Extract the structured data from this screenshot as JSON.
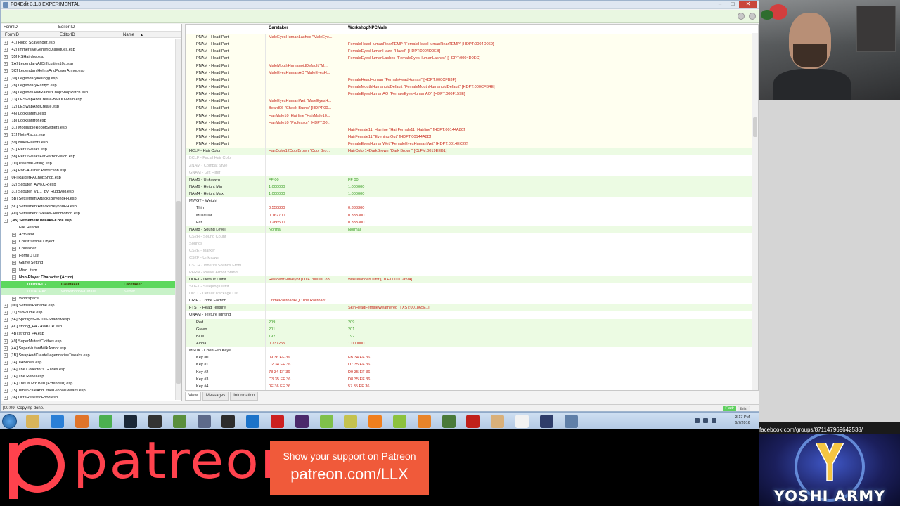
{
  "app": {
    "title": "FO4Edit 3.1.3 EXPERIMENTAL"
  },
  "filters": {
    "formid_label": "FormID",
    "editorid_label": "Editor ID"
  },
  "left_columns": {
    "formid": "FormID",
    "editorid": "EditorID",
    "name": "Name"
  },
  "tree": [
    {
      "indent": 0,
      "label": "[41] Hobo Scavenger.esp",
      "exp": "+"
    },
    {
      "indent": 0,
      "label": "[42] ImmersiveGenericDialogues.esp",
      "exp": "+"
    },
    {
      "indent": 0,
      "label": "[35] KSHairdos.esp",
      "exp": "+"
    },
    {
      "indent": 0,
      "label": "[2A] LegendaryAllDifficulties10x.esp",
      "exp": "+"
    },
    {
      "indent": 0,
      "label": "[3C] LegendaryHelmsAndPowerArmor.esp",
      "exp": "+"
    },
    {
      "indent": 0,
      "label": "[30] LegendaryKellogg.esp",
      "exp": "+"
    },
    {
      "indent": 0,
      "label": "[28] LegendaryRarity5.esp",
      "exp": "+"
    },
    {
      "indent": 0,
      "label": "[38] LegendsAndRaiderChopShopPatch.esp",
      "exp": "+"
    },
    {
      "indent": 0,
      "label": "[13] LESwapAndCreate-BMOD-Main.esp",
      "exp": "+"
    },
    {
      "indent": 0,
      "label": "[12] LESwapAndCreate.esp",
      "exp": "+"
    },
    {
      "indent": 0,
      "label": "[46] LooksMenu.esp",
      "exp": "+"
    },
    {
      "indent": 0,
      "label": "[18] LooksMirror.esp",
      "exp": "+"
    },
    {
      "indent": 0,
      "label": "[31] ModdableRobotSettlers.esp",
      "exp": "+"
    },
    {
      "indent": 0,
      "label": "[21] NoteRacks.esp",
      "exp": "+"
    },
    {
      "indent": 0,
      "label": "[59] NukaFlavors.esp",
      "exp": "+"
    },
    {
      "indent": 0,
      "label": "[57] PerkTweaks.esp",
      "exp": "+"
    },
    {
      "indent": 0,
      "label": "[58] PerkTweaksFarHarborPatch.esp",
      "exp": "+"
    },
    {
      "indent": 0,
      "label": "[1D] PlasmaGatling.esp",
      "exp": "+"
    },
    {
      "indent": 0,
      "label": "[24] Port-A-Diner Perfection.esp",
      "exp": "+"
    },
    {
      "indent": 0,
      "label": "[0F] RaiderPAChopShop.esp",
      "exp": "+"
    },
    {
      "indent": 0,
      "label": "[32] Scouter_AWKCR.esp",
      "exp": "+"
    },
    {
      "indent": 0,
      "label": "[31] Scouter_V1.1_by_Ruddy88.esp",
      "exp": "+"
    },
    {
      "indent": 0,
      "label": "[5B] SettlementAttacksBeyondFH.esp",
      "exp": "+"
    },
    {
      "indent": 0,
      "label": "[5C] SettlementAttacksBeyondFH.esp",
      "exp": "+"
    },
    {
      "indent": 0,
      "label": "[4D] SettlementTweaks-Automotron.esp",
      "exp": "+"
    },
    {
      "indent": 0,
      "label": "[3B] SettlementTweaks-Core.esp",
      "exp": "-",
      "bold": true
    },
    {
      "indent": 1,
      "label": "File Header",
      "exp": ""
    },
    {
      "indent": 1,
      "label": "Activator",
      "exp": "+"
    },
    {
      "indent": 1,
      "label": "Constructible Object",
      "exp": "+"
    },
    {
      "indent": 1,
      "label": "Container",
      "exp": "+"
    },
    {
      "indent": 1,
      "label": "FormID List",
      "exp": "+"
    },
    {
      "indent": 1,
      "label": "Game Setting",
      "exp": "+"
    },
    {
      "indent": 1,
      "label": "Misc. Item",
      "exp": "+"
    },
    {
      "indent": 1,
      "label": "Non-Player Character (Actor)",
      "exp": "-",
      "bold": true
    },
    {
      "indent": 2,
      "label": "000B3EC7",
      "exp": "",
      "c2": "Caretaker",
      "c3": "Caretaker",
      "sel": "sel"
    },
    {
      "indent": 2,
      "label": "0014CEA8",
      "exp": "",
      "c2": "WorkshopNPCMale",
      "c3": "Settler",
      "sel": "sel2"
    },
    {
      "indent": 1,
      "label": "Workspace",
      "exp": "+"
    },
    {
      "indent": 0,
      "label": "[0D] SettlersRename.esp",
      "exp": "+"
    },
    {
      "indent": 0,
      "label": "[11] SlowTime.esp",
      "exp": "+"
    },
    {
      "indent": 0,
      "label": "[5F] SpotlightFix-100-Shadow.esp",
      "exp": "+"
    },
    {
      "indent": 0,
      "label": "[4C] strong_PA - AWKCR.esp",
      "exp": "+"
    },
    {
      "indent": 0,
      "label": "[4B] strong_PA.esp",
      "exp": "+"
    },
    {
      "indent": 0,
      "label": "[49] SuperMutantClothes.esp",
      "exp": "+"
    },
    {
      "indent": 0,
      "label": "[4A] SuperMutantMilkArmor.esp",
      "exp": "+"
    },
    {
      "indent": 0,
      "label": "[1B] SwapAndCreateLegendariesTweaks.esp",
      "exp": "+"
    },
    {
      "indent": 0,
      "label": "[14] THBrows.esp",
      "exp": "+"
    },
    {
      "indent": 0,
      "label": "[3F] The Collector's Guides.esp",
      "exp": "+"
    },
    {
      "indent": 0,
      "label": "[1F] The Rebel.esp",
      "exp": "+"
    },
    {
      "indent": 0,
      "label": "[1E] This is MY Bed (Extended).esp",
      "exp": "+"
    },
    {
      "indent": 0,
      "label": "[15] TimeScaleAndOtherGlobalTweaks.esp",
      "exp": "+"
    },
    {
      "indent": 0,
      "label": "[36] UltraRealisticFood.esp",
      "exp": "+"
    }
  ],
  "record_header": {
    "col1": "Caretaker",
    "col2": "WorkshopNPCMale"
  },
  "record_rows": [
    {
      "label": "PNAM - Head Part",
      "i": 1,
      "v1": "MaleEyesHumanLashes \"MaleEye...",
      "v2": "",
      "c": "red",
      "bg": "hl"
    },
    {
      "label": "PNAM - Head Part",
      "i": 1,
      "v1": "",
      "v2": "FemaleHeadHumanRearTEMP \"FemaleHeadHumanRearTEMP\" [HDPT:0004D069]",
      "c": "red",
      "bg": "hl"
    },
    {
      "label": "PNAM - Head Part",
      "i": 1,
      "v1": "",
      "v2": "FemaleEyesHumanHazel \"Hazel\" [HDPT:0004D0EB]",
      "c": "red",
      "bg": "hl"
    },
    {
      "label": "PNAM - Head Part",
      "i": 1,
      "v1": "",
      "v2": "FemaleEyesHumanLashes \"FemaleEyesHumanLashes\" [HDPT:0004D0EC]",
      "c": "red",
      "bg": "hl"
    },
    {
      "label": "PNAM - Head Part",
      "i": 1,
      "v1": "MaleMouthHumanoidDefault \"M...",
      "v2": "",
      "c": "red",
      "bg": "hl"
    },
    {
      "label": "PNAM - Head Part",
      "i": 1,
      "v1": "MaleEyesHumanAO \"MaleEyesH...",
      "v2": "",
      "c": "red",
      "bg": "hl"
    },
    {
      "label": "PNAM - Head Part",
      "i": 1,
      "v1": "",
      "v2": "FemaleHeadHuman \"FemaleHeadHuman\" [HDPT:000CFB3F]",
      "c": "red",
      "bg": "hl"
    },
    {
      "label": "PNAM - Head Part",
      "i": 1,
      "v1": "",
      "v2": "FemaleMouthHumanoidDefault \"FemaleMouthHumanoidDefault\" [HDPT:000CFB4E]",
      "c": "red",
      "bg": "hl"
    },
    {
      "label": "PNAM - Head Part",
      "i": 1,
      "v1": "",
      "v2": "FemaleEyesHumanAO \"FemaleEyesHumanAO\" [HDPT:000F159E]",
      "c": "red",
      "bg": "hl"
    },
    {
      "label": "PNAM - Head Part",
      "i": 1,
      "v1": "MaleEyesHumanWet \"MaleEyesH...",
      "v2": "",
      "c": "red",
      "bg": "hl"
    },
    {
      "label": "PNAM - Head Part",
      "i": 1,
      "v1": "Beard06 \"Cheek Burns\" [HDPT:00...",
      "v2": "",
      "c": "red",
      "bg": "hl"
    },
    {
      "label": "PNAM - Head Part",
      "i": 1,
      "v1": "HairMale10_Hairline \"HairMale10...",
      "v2": "",
      "c": "red",
      "bg": "hl"
    },
    {
      "label": "PNAM - Head Part",
      "i": 1,
      "v1": "HairMale10 \"Professor\" [HDPT:00...",
      "v2": "",
      "c": "red",
      "bg": "hl"
    },
    {
      "label": "PNAM - Head Part",
      "i": 1,
      "v1": "",
      "v2": "HairFemale11_Hairline \"HairFemale11_Hairline\" [HDPT:00144A8C]",
      "c": "red",
      "bg": "hl"
    },
    {
      "label": "PNAM - Head Part",
      "i": 1,
      "v1": "",
      "v2": "HairFemale11 \"Evening Out\" [HDPT:00144A8D]",
      "c": "red",
      "bg": "hl"
    },
    {
      "label": "PNAM - Head Part",
      "i": 1,
      "v1": "",
      "v2": "FemaleEyesHumanWet \"FemaleEyesHumanWet\" [HDPT:0014EC22]",
      "c": "red",
      "bg": "hl"
    },
    {
      "label": "HCLF - Hair Color",
      "i": 0,
      "v1": "HairColor12CoolBrown \"Cool Bro...",
      "v2": "HairColor14DarkBrown \"Dark Brown\" [CLFM:0019EEB1]",
      "c": "red",
      "bg": "green"
    },
    {
      "label": "BCLF - Facial Hair Color",
      "i": 0,
      "v1": "",
      "v2": "",
      "c": "",
      "bg": "",
      "dim": true
    },
    {
      "label": "ZNAM - Combat Style",
      "i": 0,
      "v1": "",
      "v2": "",
      "c": "",
      "bg": "",
      "dim": true
    },
    {
      "label": "GNAM - Gift Filter",
      "i": 0,
      "v1": "",
      "v2": "",
      "c": "",
      "bg": "",
      "dim": true
    },
    {
      "label": "NAM5 - Unknown",
      "i": 0,
      "v1": "FF 00",
      "v2": "FF 00",
      "c": "grn",
      "bg": "green"
    },
    {
      "label": "NAM6 - Height Min",
      "i": 0,
      "v1": "1.000000",
      "v2": "1.000000",
      "c": "grn",
      "bg": "green"
    },
    {
      "label": "NAM4 - Height Max",
      "i": 0,
      "v1": "1.000000",
      "v2": "1.000000",
      "c": "grn",
      "bg": "green"
    },
    {
      "label": "MWGT - Weight",
      "i": 0,
      "v1": "",
      "v2": "",
      "c": "",
      "bg": ""
    },
    {
      "label": "Thin",
      "i": 1,
      "v1": "0.550800",
      "v2": "0.333300",
      "c": "red",
      "bg": ""
    },
    {
      "label": "Muscular",
      "i": 1,
      "v1": "0.162700",
      "v2": "0.333300",
      "c": "red",
      "bg": ""
    },
    {
      "label": "Fat",
      "i": 1,
      "v1": "0.286500",
      "v2": "0.333300",
      "c": "red",
      "bg": ""
    },
    {
      "label": "NAM8 - Sound Level",
      "i": 0,
      "v1": "Normal",
      "v2": "Normal",
      "c": "grn",
      "bg": "green"
    },
    {
      "label": "CS2H - Sound Count",
      "i": 0,
      "v1": "",
      "v2": "",
      "c": "",
      "bg": "",
      "dim": true
    },
    {
      "label": "Sounds",
      "i": 0,
      "v1": "",
      "v2": "",
      "c": "",
      "bg": "",
      "dim": true
    },
    {
      "label": "CS2E - Marker",
      "i": 0,
      "v1": "",
      "v2": "",
      "c": "",
      "bg": "",
      "dim": true
    },
    {
      "label": "CS2F - Unknown",
      "i": 0,
      "v1": "",
      "v2": "",
      "c": "",
      "bg": "",
      "dim": true
    },
    {
      "label": "CSCR - Inherits Sounds From",
      "i": 0,
      "v1": "",
      "v2": "",
      "c": "",
      "bg": "",
      "dim": true
    },
    {
      "label": "PFRN - Power Armor Stand",
      "i": 0,
      "v1": "",
      "v2": "",
      "c": "",
      "bg": "",
      "dim": true
    },
    {
      "label": "DOFT - Default Outfit",
      "i": 0,
      "v1": "ResidentSurveyor [OTFT:000DC83...",
      "v2": "WastelanderOutfit [OTFT:001C269A]",
      "c": "red",
      "bg": "green"
    },
    {
      "label": "SOFT - Sleeping Outfit",
      "i": 0,
      "v1": "",
      "v2": "",
      "c": "",
      "bg": "",
      "dim": true
    },
    {
      "label": "DPLT - Default Package List",
      "i": 0,
      "v1": "",
      "v2": "",
      "c": "",
      "bg": "",
      "dim": true
    },
    {
      "label": "CRIF - Crime Faction",
      "i": 0,
      "v1": "CrimeRailroadHQ \"The Railroad\" ...",
      "v2": "",
      "c": "red",
      "bg": ""
    },
    {
      "label": "FTST - Head Texture",
      "i": 0,
      "v1": "",
      "v2": "SkinHeadFemaleWeathered [TXST:001865E1]",
      "c": "red",
      "bg": "green"
    },
    {
      "label": "QNAM - Texture lighting",
      "i": 0,
      "v1": "",
      "v2": "",
      "c": "",
      "bg": ""
    },
    {
      "label": "Red",
      "i": 1,
      "v1": "209",
      "v2": "209",
      "c": "grn",
      "bg": "green"
    },
    {
      "label": "Green",
      "i": 1,
      "v1": "201",
      "v2": "201",
      "c": "grn",
      "bg": "green"
    },
    {
      "label": "Blue",
      "i": 1,
      "v1": "192",
      "v2": "192",
      "c": "grn",
      "bg": "green"
    },
    {
      "label": "Alpha",
      "i": 1,
      "v1": "0.737255",
      "v2": "1.000000",
      "c": "red",
      "bg": "green"
    },
    {
      "label": "MSDK - ChenGen Keys",
      "i": 0,
      "v1": "",
      "v2": "",
      "c": "",
      "bg": ""
    },
    {
      "label": "Key #0",
      "i": 1,
      "v1": "09 36 EF 36",
      "v2": "FB 34 EF 36",
      "c": "red",
      "bg": ""
    },
    {
      "label": "Key #1",
      "i": 1,
      "v1": "D2 34 EF 36",
      "v2": "D7 35 EF 36",
      "c": "red",
      "bg": ""
    },
    {
      "label": "Key #2",
      "i": 1,
      "v1": "78 34 EF 36",
      "v2": "D9 35 EF 36",
      "c": "red",
      "bg": ""
    },
    {
      "label": "Key #3",
      "i": 1,
      "v1": "D3 35 EF 36",
      "v2": "D8 35 EF 36",
      "c": "red",
      "bg": ""
    },
    {
      "label": "Key #4",
      "i": 1,
      "v1": "0E 36 EF 36",
      "v2": "57 35 EF 36",
      "c": "red",
      "bg": ""
    }
  ],
  "tabs": [
    "View",
    "Messages",
    "Information"
  ],
  "status": {
    "text": "[00:09] Copying done.",
    "flair": "Flattr",
    "this": "this!"
  },
  "clock": {
    "time": "3:17 PM",
    "date": "6/7/2016"
  },
  "taskbar_icons": [
    "explorer-icon",
    "ie-icon",
    "firefox-icon",
    "chrome-icon",
    "steam-icon",
    "obs-icon",
    "game-icon",
    "media-icon",
    "shield-icon",
    "photoshop-icon",
    "record-icon",
    "premiere-icon",
    "leaf-icon",
    "paint-icon",
    "vlc-cone-icon",
    "utorrent-icon",
    "cone-icon",
    "tree-icon",
    "filezilla-icon",
    "ftp-icon",
    "notepad-icon",
    "fo4edit-icon",
    "network-icon"
  ],
  "overlay": {
    "patreon_word": "patreon",
    "patreon_line1": "Show your support on Patreon",
    "patreon_line2": "patreon.com/LLX",
    "facebook_url": "facebook.com/groups/871147969642538/",
    "yoshi_text": "YOSHI ARMY"
  },
  "colors": {
    "accent_green": "#5dd85d",
    "patreon_red": "#ff424d",
    "patreon_box": "#f05a3a",
    "diff_red": "#c8281c",
    "same_green": "#3a9e24"
  }
}
